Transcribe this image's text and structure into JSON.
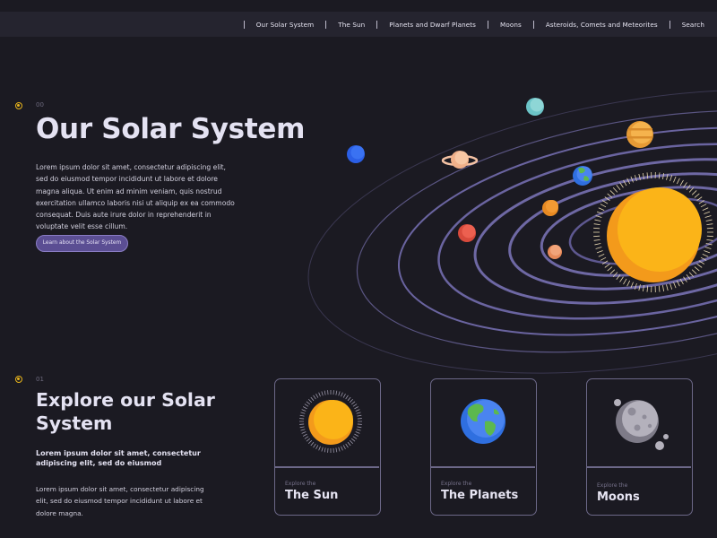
{
  "nav": {
    "items": [
      {
        "label": "Our Solar System"
      },
      {
        "label": "The Sun"
      },
      {
        "label": "Planets and Dwarf Planets"
      },
      {
        "label": "Moons"
      },
      {
        "label": "Asteroids, Comets and Meteorites"
      },
      {
        "label": "Search"
      }
    ]
  },
  "hero": {
    "number": "00",
    "title": "Our Solar System",
    "body": "Lorem ipsum dolor sit amet, consectetur adipiscing elit, sed do eiusmod tempor incididunt ut labore et dolore magna aliqua. Ut enim ad minim veniam, quis nostrud exercitation ullamco laboris nisi ut aliquip ex ea commodo consequat. Duis aute irure dolor in reprehenderit in voluptate velit esse cillum.",
    "cta_label": "Learn about the Solar System"
  },
  "explore": {
    "number": "01",
    "title": "Explore our Solar System",
    "subtitle": "Lorem ipsum dolor sit amet, consectetur adipiscing elit, sed do eiusmod",
    "body": "Lorem ipsum dolor sit amet, consectetur adipiscing elit, sed do eiusmod tempor incididunt ut labore et dolore magna."
  },
  "cards": [
    {
      "kicker": "Explore the",
      "title": "The Sun"
    },
    {
      "kicker": "Explore the",
      "title": "The Planets"
    },
    {
      "kicker": "Explore the",
      "title": "Moons"
    }
  ],
  "colors": {
    "background": "#1b1a22",
    "navbar": "#25242f",
    "accent_button": "#5b4e93",
    "marker": "#e8b41c",
    "orbit": "#6e68a0",
    "sun": "#fbb418"
  }
}
